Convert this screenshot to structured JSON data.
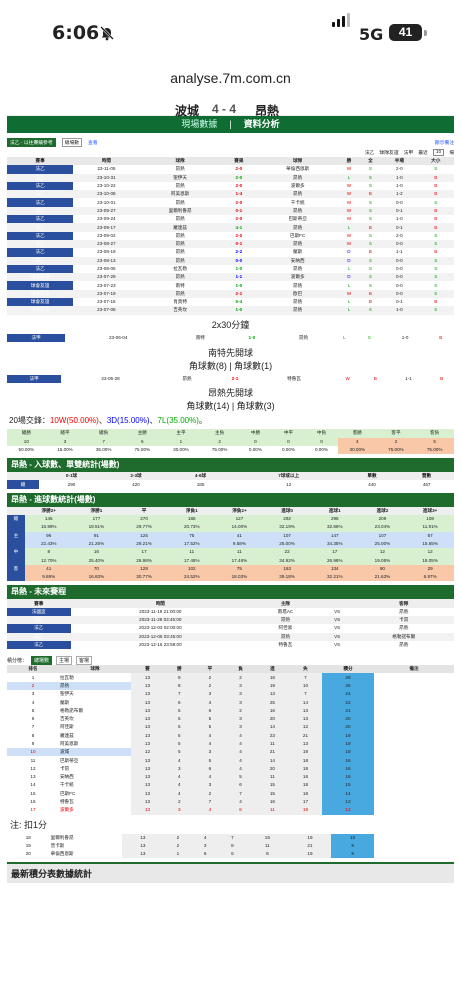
{
  "status": {
    "time": "6:06",
    "network": "5G",
    "battery": "41"
  },
  "browser": {
    "url": "analyse.7m.com.cn"
  },
  "header": {
    "team_a": "波城",
    "score": "4 - 4",
    "team_b": "昂熱",
    "tabs": [
      "現場數據",
      "資料分析"
    ]
  },
  "filters": {
    "left": [
      "法乙 - 以往賽績參考",
      "總場數",
      "查看"
    ],
    "right_options": [
      "顯示備注",
      "法乙",
      "球隊友誼",
      "法甲",
      "最近",
      "10",
      "場"
    ],
    "cols": [
      "賽事",
      "時間",
      "球隊",
      "賽果",
      "球隊",
      "勝",
      "全",
      "半場",
      "大小"
    ]
  },
  "recent": [
    [
      "法乙",
      "23-11-05",
      "昂熱",
      "2-0",
      "華倫西恩斯",
      "W",
      "S",
      "E",
      "2-0",
      "S"
    ],
    [
      "法乙",
      "23-10-31",
      "聖伊天",
      "2-0",
      "昂熱",
      "L",
      "S",
      "E",
      "1-0",
      "B"
    ],
    [
      "法乙",
      "23-10-22",
      "昂熱",
      "2-0",
      "波爾多",
      "W",
      "S",
      "E",
      "1-0",
      "B"
    ],
    [
      "法乙",
      "23-10-08",
      "阿美恩斯",
      "1-4",
      "昂熱",
      "W",
      "B",
      "O",
      "1-2",
      "B"
    ],
    [
      "法乙",
      "23-10-01",
      "昂熱",
      "2-0",
      "干卡統",
      "W",
      "S",
      "E",
      "0-0",
      "S"
    ],
    [
      "法乙",
      "23-09-27",
      "里爾利魯昂",
      "0-1",
      "昂熱",
      "W",
      "S",
      "O",
      "0-1",
      "B"
    ],
    [
      "法乙",
      "23-09-24",
      "昂熱",
      "2-0",
      "巴斯蒂亞",
      "W",
      "S",
      "E",
      "1-0",
      "B"
    ],
    [
      "法乙",
      "23-09-17",
      "羅連茲",
      "4-1",
      "昂熱",
      "L",
      "B",
      "O",
      "0-1",
      "B"
    ],
    [
      "法乙",
      "23-09-02",
      "昂熱",
      "2-0",
      "巴斯FC",
      "W",
      "S",
      "E",
      "2-0",
      "S"
    ],
    [
      "法乙",
      "23-08-27",
      "昂熱",
      "0-1",
      "昂熱",
      "W",
      "S",
      "O",
      "0-0",
      "S"
    ],
    [
      "法乙",
      "23-08-19",
      "昂熱",
      "2-2",
      "蘭斯",
      "D",
      "B",
      "E",
      "1-1",
      "B"
    ],
    [
      "法乙",
      "23-08-13",
      "昂熱",
      "0-0",
      "安納西",
      "D",
      "S",
      "E",
      "0-0",
      "S"
    ],
    [
      "法乙",
      "23-08-06",
      "拉瓦勒",
      "1-0",
      "昂熱",
      "L",
      "S",
      "O",
      "0-0",
      "S"
    ],
    [
      "球會友誼",
      "23-07-29",
      "昂熱",
      "1-1",
      "波爾多",
      "D",
      "S",
      "E",
      "0-0",
      "S"
    ],
    [
      "球會友誼",
      "23-07-23",
      "南特",
      "1-0",
      "昂熱",
      "L",
      "S",
      "O",
      "0-0",
      "S"
    ],
    [
      "球會友誼",
      "23-07-19",
      "昂熱",
      "2-1",
      "歐巴",
      "W",
      "B",
      "O",
      "0-0",
      "S"
    ],
    [
      "球會友誼",
      "23-07-16",
      "肖莫特",
      "5-4",
      "昂熱",
      "L",
      "B",
      "O",
      "0-1",
      "B"
    ],
    [
      "球會友誼",
      "23-07-08",
      "吉英坎",
      "1-0",
      "昂熱",
      "L",
      "S",
      "O",
      "1-0",
      "S"
    ]
  ],
  "extra": {
    "note1": "2x30分鐘",
    "row1": [
      "法甲",
      "23-06-04",
      "南特",
      "1-0",
      "昂熱",
      "L",
      "S",
      "O",
      "1-0",
      "B"
    ],
    "note2": "南特先開球",
    "note3": "角球數(8) | 角球數(1)",
    "row2": [
      "法甲",
      "23-05-28",
      "昂熱",
      "2-1",
      "特魯瓦",
      "W",
      "B",
      "O",
      "1-1",
      "B"
    ],
    "note4": "昂熱先開球",
    "note5": "角球數(14) | 角球數(3)"
  },
  "summary": {
    "prefix": "20場交鋒：",
    "w": "10W(50.00%)",
    "sep1": "、",
    "d": "3D(15.00%)",
    "sep2": "、",
    "l": "7L(35.00%)",
    "suffix": "。"
  },
  "odds": {
    "head": [
      "總勝",
      "總平",
      "總負",
      "主勝",
      "主平",
      "主負",
      "中勝",
      "中平",
      "中負",
      "客勝",
      "客平",
      "客負"
    ],
    "vals": [
      "10",
      "3",
      "7",
      "6",
      "1",
      "2",
      "0",
      "0",
      "0",
      "4",
      "2",
      "5"
    ],
    "pcts": [
      "50.00%",
      "15.00%",
      "35.00%",
      "75.00%",
      "30.00%",
      "75.00%",
      "0.00%",
      "0.00%",
      "0.00%",
      "30.00%",
      "75.00%",
      "75.00%"
    ]
  },
  "sec1": {
    "title": "昂熱 - 入球數、單雙統計(場數)",
    "head": [
      "",
      "0-1球",
      "2-3球",
      "4-6球",
      "7球或以上",
      "單數",
      "雙數"
    ],
    "row": [
      "總",
      "290",
      "420",
      "185",
      "12",
      "440",
      "467"
    ]
  },
  "sec2": {
    "title": "昂熱 - 進球數統計(場數)",
    "head": [
      "",
      "淨勝2+",
      "淨勝1",
      "平",
      "淨負1",
      "淨負2+",
      "進球0",
      "進球1",
      "進球2",
      "進球3+"
    ],
    "rows": [
      [
        "總",
        "145",
        "177",
        "270",
        "188",
        "127",
        "292",
        "298",
        "209",
        "108"
      ],
      [
        "",
        "15.99%",
        "19.51%",
        "29.77%",
        "20.73%",
        "14.00%",
        "32.19%",
        "32.86%",
        "23.04%",
        "11.91%"
      ],
      [
        "主",
        "96",
        "91",
        "125",
        "75",
        "41",
        "107",
        "147",
        "107",
        "67"
      ],
      [
        "",
        "22.43%",
        "21.26%",
        "29.21%",
        "17.52%",
        "9.58%",
        "25.00%",
        "34.35%",
        "25.00%",
        "15.65%"
      ],
      [
        "中",
        "8",
        "16",
        "17",
        "11",
        "11",
        "22",
        "17",
        "12",
        "12"
      ],
      [
        "",
        "12.70%",
        "25.40%",
        "26.98%",
        "17.46%",
        "17.46%",
        "34.92%",
        "26.98%",
        "19.05%",
        "19.05%"
      ],
      [
        "客",
        "41",
        "70",
        "128",
        "102",
        "75",
        "163",
        "134",
        "90",
        "29"
      ],
      [
        "",
        "9.86%",
        "16.83%",
        "30.77%",
        "24.52%",
        "18.03%",
        "39.18%",
        "32.21%",
        "21.63%",
        "6.97%"
      ]
    ]
  },
  "sec3": {
    "title": "昂熱 - 未來賽程",
    "head": [
      "賽事",
      "時間",
      "主隊",
      "",
      "客隊"
    ],
    "rows": [
      [
        "法國盃",
        "2023-11-18 21:00:00",
        "南塔AC",
        "VS",
        "昂熱"
      ],
      [
        "法乙",
        "2023-11-28 03:45:00",
        "昂熱",
        "VS",
        "卡昂"
      ],
      [
        "法乙",
        "2023-12-03 02:00:00",
        "阿佳索",
        "VS",
        "昂熱"
      ],
      [
        "法乙",
        "2023-12-06 03:45:00",
        "昂熱",
        "VS",
        "格勒諾布爾"
      ],
      [
        "法乙",
        "2023-12-16 23:59:00",
        "特魯瓦",
        "VS",
        "昂熱"
      ]
    ]
  },
  "standings": {
    "tabs": [
      "積分榜：",
      "總場數",
      "主場",
      "客場"
    ],
    "head": [
      "排名",
      "球隊",
      "賽",
      "勝",
      "平",
      "負",
      "進",
      "失",
      "積分",
      "備注"
    ],
    "rows": [
      [
        "1",
        "拉瓦勒",
        "13",
        "9",
        "2",
        "2",
        "16",
        "7",
        "29"
      ],
      [
        "2",
        "昂熱",
        "13",
        "8",
        "2",
        "3",
        "19",
        "10",
        "26"
      ],
      [
        "3",
        "聖伊天",
        "13",
        "7",
        "3",
        "3",
        "13",
        "7",
        "24"
      ],
      [
        "4",
        "蘭斯",
        "13",
        "6",
        "4",
        "3",
        "25",
        "14",
        "22"
      ],
      [
        "5",
        "格勒諾布爾",
        "13",
        "5",
        "6",
        "2",
        "16",
        "13",
        "21"
      ],
      [
        "6",
        "吉英坎",
        "13",
        "5",
        "5",
        "3",
        "20",
        "13",
        "20"
      ],
      [
        "7",
        "阿佳斯",
        "13",
        "5",
        "5",
        "3",
        "14",
        "12",
        "20"
      ],
      [
        "8",
        "羅連茲",
        "13",
        "5",
        "4",
        "4",
        "23",
        "21",
        "19"
      ],
      [
        "9",
        "阿美恩斯",
        "13",
        "5",
        "4",
        "4",
        "11",
        "13",
        "19"
      ],
      [
        "10",
        "波城",
        "12",
        "5",
        "3",
        "4",
        "21",
        "19",
        "18"
      ],
      [
        "11",
        "巴斯蒂亞",
        "13",
        "4",
        "5",
        "4",
        "14",
        "18",
        "16"
      ],
      [
        "12",
        "卡昂",
        "13",
        "3",
        "6",
        "4",
        "20",
        "18",
        "16"
      ],
      [
        "13",
        "安納西",
        "13",
        "4",
        "4",
        "5",
        "11",
        "16",
        "16"
      ],
      [
        "14",
        "干卡統",
        "13",
        "4",
        "3",
        "6",
        "15",
        "18",
        "15"
      ],
      [
        "15",
        "巴斯FC",
        "13",
        "4",
        "2",
        "7",
        "15",
        "18",
        "14"
      ],
      [
        "16",
        "特魯瓦",
        "13",
        "2",
        "7",
        "4",
        "16",
        "17",
        "13"
      ],
      [
        "17",
        "波爾多",
        "13",
        "3",
        "4",
        "6",
        "11",
        "19",
        "12"
      ]
    ],
    "note": "注: 扣1分",
    "rows2": [
      [
        "18",
        "里爾利魯昂",
        "13",
        "2",
        "4",
        "7",
        "15",
        "19",
        "10"
      ],
      [
        "19",
        "普卡斯",
        "13",
        "2",
        "3",
        "8",
        "11",
        "21",
        "9"
      ],
      [
        "20",
        "華倫西恩斯",
        "13",
        "1",
        "6",
        "6",
        "8",
        "19",
        "9"
      ]
    ]
  },
  "footer": {
    "title": "最新積分表數據統計"
  }
}
